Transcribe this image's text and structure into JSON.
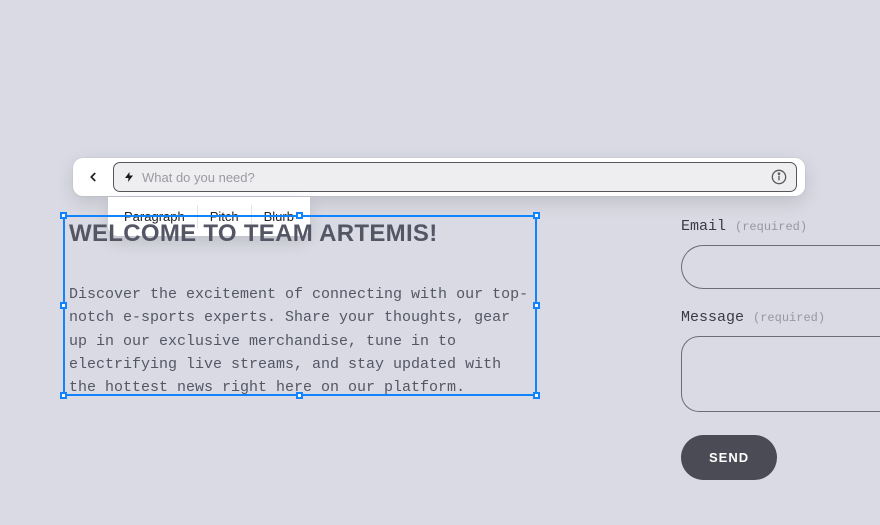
{
  "search": {
    "placeholder": "What do you need?"
  },
  "pills": {
    "items": [
      {
        "label": "Paragraph"
      },
      {
        "label": "Pitch"
      },
      {
        "label": "Blurb"
      }
    ]
  },
  "content": {
    "title": "WELCOME TO TEAM ARTEMIS!",
    "body": "Discover the excitement of connecting with our top-notch e-sports experts. Share your thoughts, gear up in our exclusive merchandise, tune in to electrifying live streams, and stay updated with the hottest news right here on our platform."
  },
  "form": {
    "email_label": "Email",
    "email_required": "(required)",
    "message_label": "Message",
    "message_required": "(required)",
    "send_label": "SEND"
  }
}
